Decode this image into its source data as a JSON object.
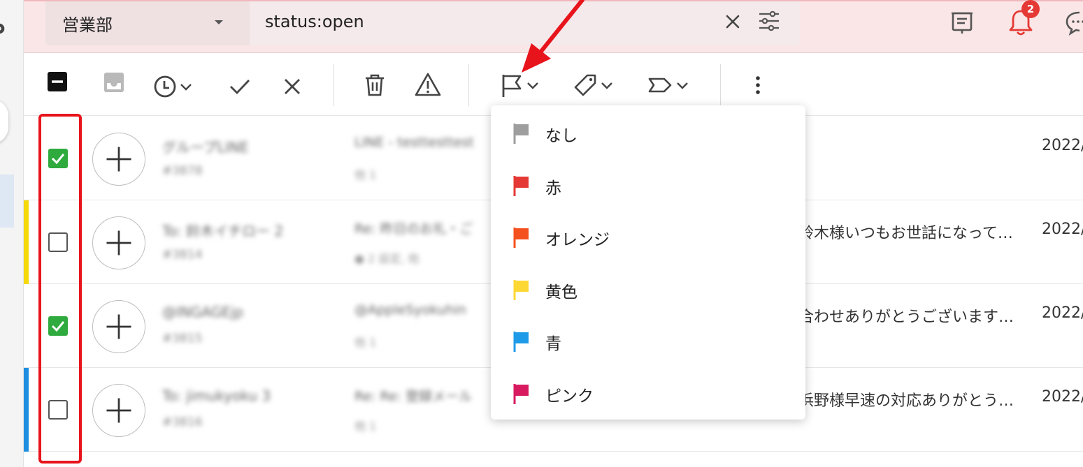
{
  "header": {
    "inbox_name": "営業部",
    "query": "status:open",
    "notification_count": "2"
  },
  "toolbar": {
    "icons": [
      "select-all-icon",
      "inbox-icon",
      "clock-icon",
      "check-icon",
      "close-icon",
      "trash-icon",
      "warning-icon",
      "flag-icon",
      "tag-icon",
      "label-icon",
      "more-vertical-icon"
    ]
  },
  "flag_menu": {
    "items": [
      {
        "label": "なし",
        "color": "#9e9e9e"
      },
      {
        "label": "赤",
        "color": "#e53935"
      },
      {
        "label": "オレンジ",
        "color": "#f4511e"
      },
      {
        "label": "黄色",
        "color": "#fdd835"
      },
      {
        "label": "青",
        "color": "#1e9be8"
      },
      {
        "label": "ピンク",
        "color": "#d81b60"
      }
    ]
  },
  "rows": [
    {
      "checked": true,
      "stripe": "",
      "name": "グループLINE",
      "id": "#3878",
      "subject": "LINE - testtesttest",
      "meta": "他 1",
      "preview": "",
      "date": "2022/"
    },
    {
      "checked": false,
      "stripe": "#f5d90a",
      "name": "To: 鈴木イチロー 2",
      "id": "#3814",
      "subject": "Re: 昨日のお礼・ご",
      "meta": "● 2 設定, 他",
      "preview": "鈴木様いつもお世話になって…",
      "date": "2022/"
    },
    {
      "checked": true,
      "stripe": "",
      "name": "@INGAGEjp",
      "id": "#3815",
      "subject": "@AppleSyokuhin",
      "meta": "他 1",
      "preview": "合わせありがとうございます…",
      "date": "2022/"
    },
    {
      "checked": false,
      "stripe": "#1e8fe0",
      "name": "To: jimukyoku 3",
      "id": "#3816",
      "subject": "Re: Re: 登録メール",
      "meta": "他 1",
      "preview": "浜野様早速の対応ありがとう…",
      "date": "2022/"
    }
  ]
}
